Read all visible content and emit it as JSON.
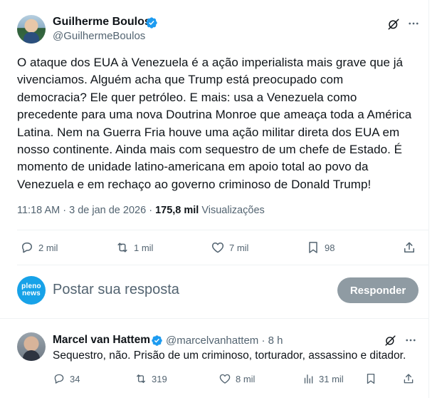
{
  "post": {
    "author_name": "Guilherme Boulos",
    "author_handle": "@GuilhermeBoulos",
    "text": "O ataque dos EUA à Venezuela é a ação imperialista mais grave que já\nvivenciamos. Alguém acha que Trump está preocupado com\ndemocracia? Ele quer petróleo. E mais: usa a Venezuela como\nprecedente para uma nova Doutrina Monroe que ameaça toda a América\nLatina. Nem na Guerra Fria houve uma ação militar direta dos EUA em\nnosso continente. Ainda mais com sequestro de um chefe de Estado. É\nmomento de unidade latino-americana em apoio total  ao povo da\nVenezuela e em rechaço ao governo criminoso de Donald Trump!",
    "time": "11:18 AM",
    "separator": "·",
    "date": "3 de jan de 2026",
    "views_count": "175,8 mil",
    "views_label": "Visualizações",
    "stats": {
      "replies": "2 mil",
      "reposts": "1 mil",
      "likes": "7 mil",
      "bookmarks": "98"
    }
  },
  "reply_composer": {
    "avatar_line1": "pleno",
    "avatar_line2": "news",
    "placeholder": "Postar sua resposta",
    "button_label": "Responder"
  },
  "comment": {
    "author_name": "Marcel van Hattem",
    "author_handle": "@marcelvanhattem · 8 h",
    "text": "Sequestro, não. Prisão de um criminoso, torturador, assassino e ditador.",
    "stats": {
      "replies": "34",
      "reposts": "319",
      "likes": "8 mil",
      "views": "31 mil"
    }
  },
  "colors": {
    "text_primary": "#0f1419",
    "text_secondary": "#536471",
    "verified": "#1d9bf0",
    "button_disabled": "#8f9ba3",
    "divider": "#eff3f4"
  }
}
